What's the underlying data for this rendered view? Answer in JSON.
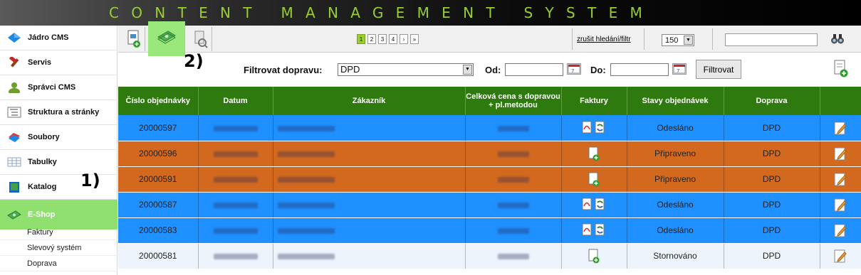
{
  "header": {
    "title": "CONTENT MANAGEMENT SYSTEM"
  },
  "sidebar": {
    "items": [
      {
        "label": "Jádro CMS"
      },
      {
        "label": "Servis"
      },
      {
        "label": "Správci CMS"
      },
      {
        "label": "Struktura a stránky"
      },
      {
        "label": "Soubory"
      },
      {
        "label": "Tabulky"
      },
      {
        "label": "Katalog"
      },
      {
        "label": "E-Shop"
      }
    ],
    "sub_items": [
      {
        "label": "Faktury"
      },
      {
        "label": "Slevový systém"
      },
      {
        "label": "Doprava"
      }
    ]
  },
  "markers": {
    "one": "1)",
    "two": "2)"
  },
  "toolbar": {
    "pages": [
      "1",
      "2",
      "3",
      "4",
      "›",
      "»"
    ],
    "cancel_filter": "zrušit hledání/filtr",
    "per_page": "150"
  },
  "filter": {
    "label": "Filtrovat dopravu:",
    "selected": "DPD",
    "from_label": "Od:",
    "to_label": "Do:",
    "button": "Filtrovat"
  },
  "table": {
    "headers": [
      "Číslo objednávky",
      "Datum",
      "Zákazník",
      "Celková cena s dopravou + pl.metodou",
      "Faktury",
      "Stavy objednávek",
      "Doprava",
      ""
    ],
    "rows": [
      {
        "number": "20000597",
        "status": "Odesláno",
        "shipping": "DPD",
        "color": "blue"
      },
      {
        "number": "20000596",
        "status": "Připraveno",
        "shipping": "DPD",
        "color": "orange"
      },
      {
        "number": "20000591",
        "status": "Připraveno",
        "shipping": "DPD",
        "color": "orange"
      },
      {
        "number": "20000587",
        "status": "Odesláno",
        "shipping": "DPD",
        "color": "blue"
      },
      {
        "number": "20000583",
        "status": "Odesláno",
        "shipping": "DPD",
        "color": "blue"
      },
      {
        "number": "20000581",
        "status": "Stornováno",
        "shipping": "DPD",
        "color": "white"
      }
    ]
  },
  "colors": {
    "accent_green": "#9acd32",
    "header_green": "#2f7a0f",
    "row_blue": "#1e90ff",
    "row_orange": "#d2691e",
    "highlight": "#90e070"
  }
}
